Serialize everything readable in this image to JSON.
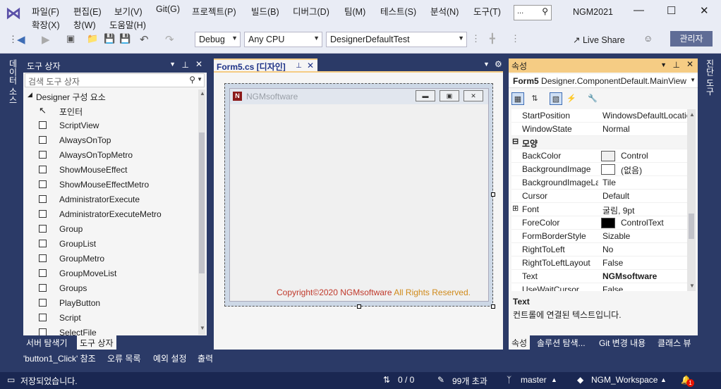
{
  "menu": {
    "items": [
      "파일(F)",
      "편집(E)",
      "보기(V)",
      "Git(G)",
      "프로젝트(P)",
      "빌드(B)",
      "디버그(D)",
      "팀(M)",
      "테스트(S)",
      "분석(N)",
      "도구(T)",
      "확장(X)",
      "창(W)",
      "도움말(H)"
    ],
    "search_placeholder": "...",
    "app_name": "NGM2021"
  },
  "toolbar": {
    "config": "Debug",
    "platform": "Any CPU",
    "startup": "DesignerDefaultTest",
    "live_share": "Live Share",
    "admin": "관리자"
  },
  "side_tabs": {
    "left": "데이터 소스",
    "right": "진단 도구"
  },
  "toolbox": {
    "title": "도구 상자",
    "search_placeholder": "검색 도구 상자",
    "group": "Designer 구성 요소",
    "items": [
      "포인터",
      "ScriptView",
      "AlwaysOnTop",
      "AlwaysOnTopMetro",
      "ShowMouseEffect",
      "ShowMouseEffectMetro",
      "AdministratorExecute",
      "AdministratorExecuteMetro",
      "Group",
      "GroupList",
      "GroupMetro",
      "GroupMoveList",
      "Groups",
      "PlayButton",
      "Script",
      "SelectFile"
    ],
    "tabs": [
      "서버 탐색기",
      "도구 상자"
    ]
  },
  "designer": {
    "tab": "Form5.cs [디자인]",
    "form_title": "NGMsoftware",
    "copyright_a": "Copyright©2020 NGMsoftware",
    "copyright_b": " All Rights Reserved."
  },
  "properties": {
    "title": "속성",
    "object_name": "Form5",
    "object_type": "Designer.ComponentDefault.MainView",
    "rows": [
      {
        "name": "StartPosition",
        "value": "WindowsDefaultLocation"
      },
      {
        "name": "WindowState",
        "value": "Normal"
      },
      {
        "name": "모양",
        "value": "",
        "category": true
      },
      {
        "name": "BackColor",
        "value": "Control",
        "swatch": "#f0f0f0"
      },
      {
        "name": "BackgroundImage",
        "value": "(없음)",
        "swatch": "#ffffff"
      },
      {
        "name": "BackgroundImageLayout",
        "value": "Tile"
      },
      {
        "name": "Cursor",
        "value": "Default"
      },
      {
        "name": "Font",
        "value": "굴림, 9pt",
        "expandable": true
      },
      {
        "name": "ForeColor",
        "value": "ControlText",
        "swatch": "#000000"
      },
      {
        "name": "FormBorderStyle",
        "value": "Sizable"
      },
      {
        "name": "RightToLeft",
        "value": "No"
      },
      {
        "name": "RightToLeftLayout",
        "value": "False"
      },
      {
        "name": "Text",
        "value": "NGMsoftware",
        "bold": true
      },
      {
        "name": "UseWaitCursor",
        "value": "False"
      }
    ],
    "desc_title": "Text",
    "desc_text": "컨트롤에 연결된 텍스트입니다.",
    "tabs": [
      "속성",
      "솔루션 탐색...",
      "Git 변경 내용",
      "클래스 뷰"
    ]
  },
  "output_tabs": [
    "'button1_Click' 참조",
    "오류 목록",
    "예외 설정",
    "출력"
  ],
  "status": {
    "message": "저장되었습니다.",
    "updown": "0 / 0",
    "edits": "99개 초과",
    "branch": "master",
    "repo": "NGM_Workspace",
    "notifications": "1"
  },
  "colors": {
    "accent": "#2b3a67",
    "tab_highlight": "#f5cc84",
    "copyright_red": "#c0392b",
    "copyright_orange": "#d08a1a"
  }
}
